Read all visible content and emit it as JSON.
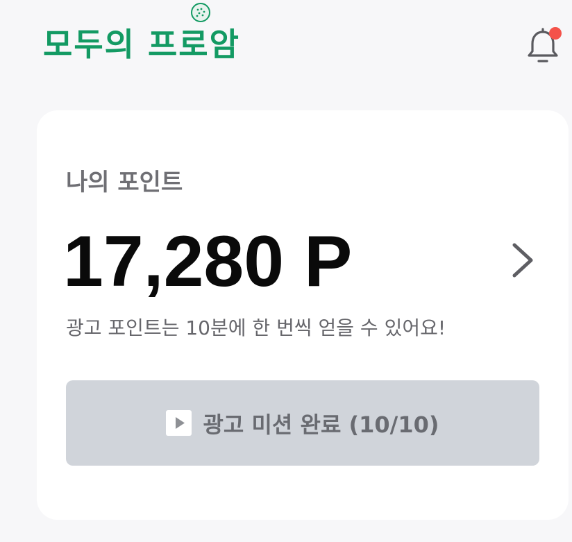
{
  "header": {
    "logo_text": "모두의 프로암",
    "icons": {
      "logo_ball": "golf-ball-icon",
      "notification": "bell-icon"
    },
    "has_notification_badge": true
  },
  "points_card": {
    "label": "나의 포인트",
    "value": "17,280 P",
    "description": "광고 포인트는 10분에 한 번씩 얻을 수 있어요!",
    "chevron_icon": "chevron-right-icon",
    "mission_button": {
      "label": "광고 미션 완료 (10/10)",
      "icon": "play-icon",
      "completed": 10,
      "total": 10
    }
  },
  "colors": {
    "brand": "#139a63",
    "badge": "#f4524a",
    "button_disabled_bg": "#d0d4da",
    "page_bg": "#f7f7f9"
  }
}
